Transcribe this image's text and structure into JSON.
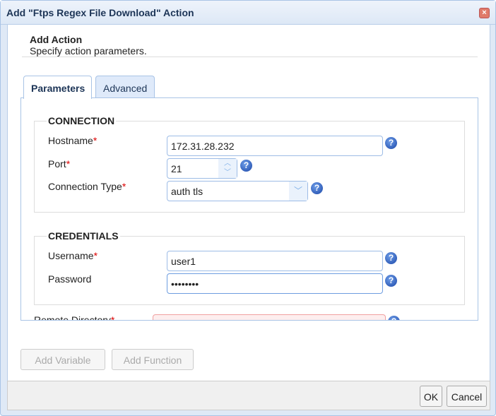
{
  "dialog": {
    "title": "Add \"Ftps Regex File Download\" Action",
    "close_icon": "close-icon"
  },
  "header": {
    "title": "Add Action",
    "subtitle": "Specify action parameters."
  },
  "tabs": [
    {
      "label": "Parameters",
      "active": true
    },
    {
      "label": "Advanced",
      "active": false
    }
  ],
  "connection": {
    "legend": "CONNECTION",
    "hostname": {
      "label": "Hostname",
      "value": "172.31.28.232"
    },
    "port": {
      "label": "Port",
      "value": "21"
    },
    "type": {
      "label": "Connection Type",
      "value": "auth tls"
    }
  },
  "credentials": {
    "legend": "CREDENTIALS",
    "username": {
      "label": "Username",
      "value": "user1"
    },
    "password": {
      "label": "Password",
      "value": "••••••••"
    }
  },
  "remote_directory": {
    "label": "Remote Directory",
    "value": ""
  },
  "required_mark": "*",
  "help_glyph": "?",
  "buttons": {
    "add_variable": "Add Variable",
    "add_function": "Add Function",
    "ok": "OK",
    "cancel": "Cancel"
  }
}
